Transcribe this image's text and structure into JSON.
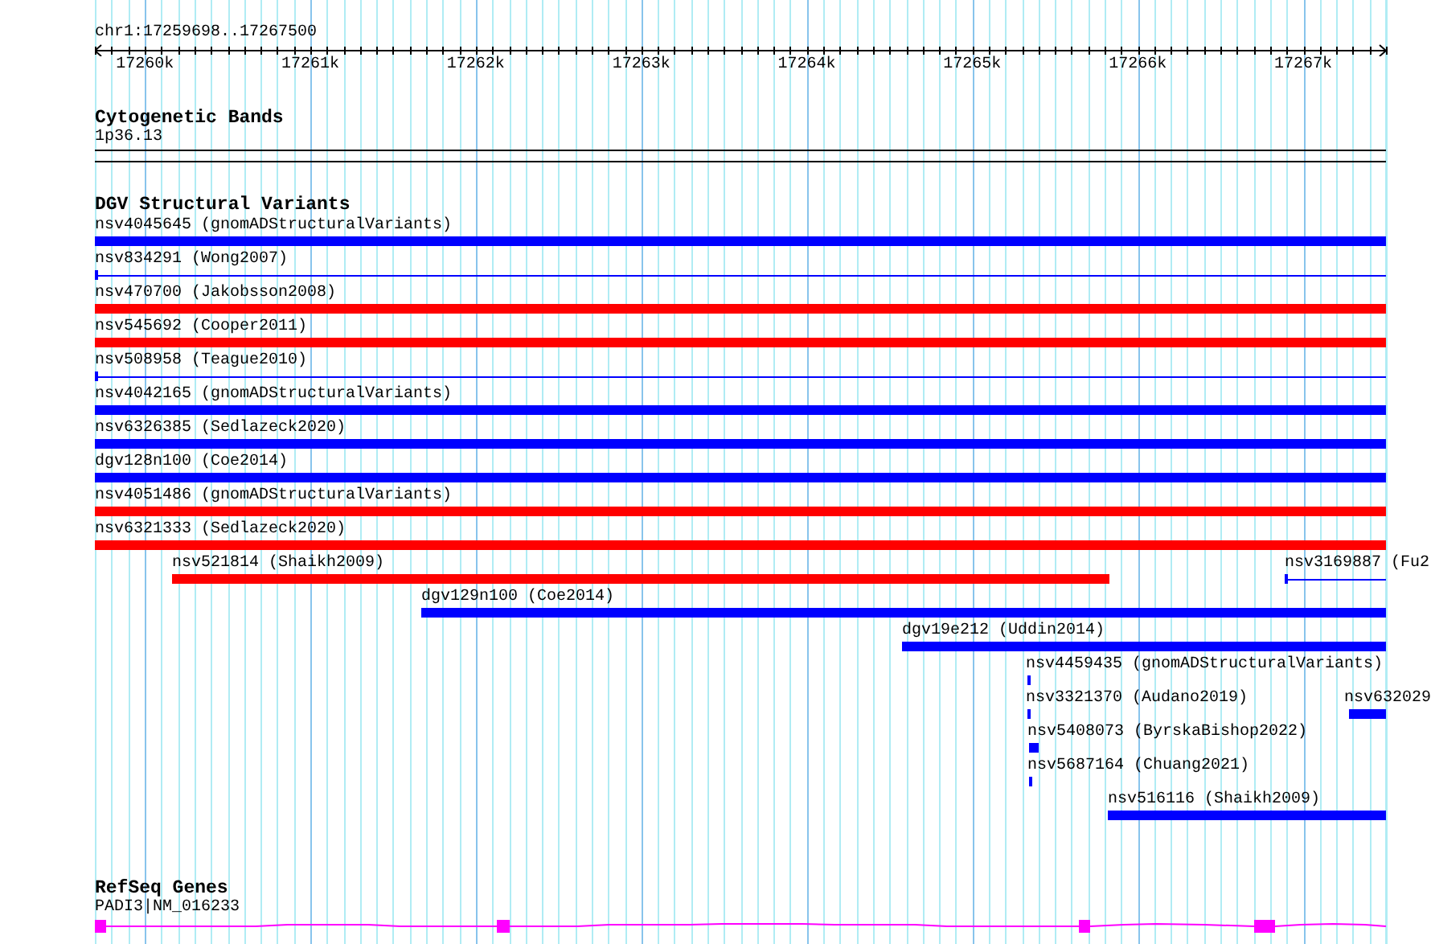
{
  "ruler": {
    "range": "chr1:17259698..17267500",
    "ticks": [
      "17260k",
      "17261k",
      "17262k",
      "17263k",
      "17264k",
      "17265k",
      "17266k",
      "17267k"
    ]
  },
  "bands": {
    "title": "Cytogenetic Bands",
    "label": "1p36.13"
  },
  "variants": {
    "title": "DGV Structural Variants",
    "rows": [
      {
        "features": [
          {
            "label": "nsv4045645 (gnomADStructuralVariants)",
            "kind": "thick",
            "color": "#0000ff"
          }
        ]
      },
      {
        "features": [
          {
            "label": "nsv834291 (Wong2007)",
            "kind": "thin",
            "color": "#0000ff"
          }
        ]
      },
      {
        "features": [
          {
            "label": "nsv470700 (Jakobsson2008)",
            "kind": "thick",
            "color": "#ff0000"
          }
        ]
      },
      {
        "features": [
          {
            "label": "nsv545692 (Cooper2011)",
            "kind": "thick",
            "color": "#ff0000"
          }
        ]
      },
      {
        "features": [
          {
            "label": "nsv508958 (Teague2010)",
            "kind": "thin",
            "color": "#0000ff"
          }
        ]
      },
      {
        "features": [
          {
            "label": "nsv4042165 (gnomADStructuralVariants)",
            "kind": "thick",
            "color": "#0000ff"
          }
        ]
      },
      {
        "features": [
          {
            "label": "nsv6326385 (Sedlazeck2020)",
            "kind": "thick",
            "color": "#0000ff"
          }
        ]
      },
      {
        "features": [
          {
            "label": "dgv128n100 (Coe2014)",
            "kind": "thick",
            "color": "#0000ff"
          }
        ]
      },
      {
        "features": [
          {
            "label": "nsv4051486 (gnomADStructuralVariants)",
            "kind": "thick",
            "color": "#ff0000"
          }
        ]
      },
      {
        "features": [
          {
            "label": "nsv6321333 (Sedlazeck2020)",
            "kind": "thick",
            "color": "#ff0000"
          }
        ]
      },
      {
        "features": [
          {
            "label": "nsv521814 (Shaikh2009)",
            "kind": "thick",
            "color": "#ff0000"
          },
          {
            "label": "nsv3169887 (Fu2",
            "kind": "thin",
            "color": "#0000ff"
          }
        ]
      },
      {
        "features": [
          {
            "label": "dgv129n100 (Coe2014)",
            "kind": "thick",
            "color": "#0000ff"
          }
        ]
      },
      {
        "features": [
          {
            "label": "dgv19e212 (Uddin2014)",
            "kind": "thick",
            "color": "#0000ff"
          }
        ]
      },
      {
        "features": [
          {
            "label": "nsv4459435 (gnomADStructuralVariants)",
            "kind": "thick",
            "color": "#0000ff"
          }
        ]
      },
      {
        "features": [
          {
            "label": "nsv3321370 (Audano2019)",
            "kind": "thick",
            "color": "#0000ff"
          },
          {
            "label": "nsv632029",
            "kind": "thick",
            "color": "#0000ff"
          }
        ]
      },
      {
        "features": [
          {
            "label": "nsv5408073 (ByrskaBishop2022)",
            "kind": "thick",
            "color": "#0000ff"
          }
        ]
      },
      {
        "features": [
          {
            "label": "nsv5687164 (Chuang2021)",
            "kind": "thick",
            "color": "#0000ff"
          }
        ]
      },
      {
        "features": [
          {
            "label": "nsv516116 (Shaikh2009)",
            "kind": "thick",
            "color": "#0000ff"
          }
        ]
      }
    ]
  },
  "genes": {
    "title": "RefSeq Genes",
    "label": "PADI3|NM_016233"
  }
}
